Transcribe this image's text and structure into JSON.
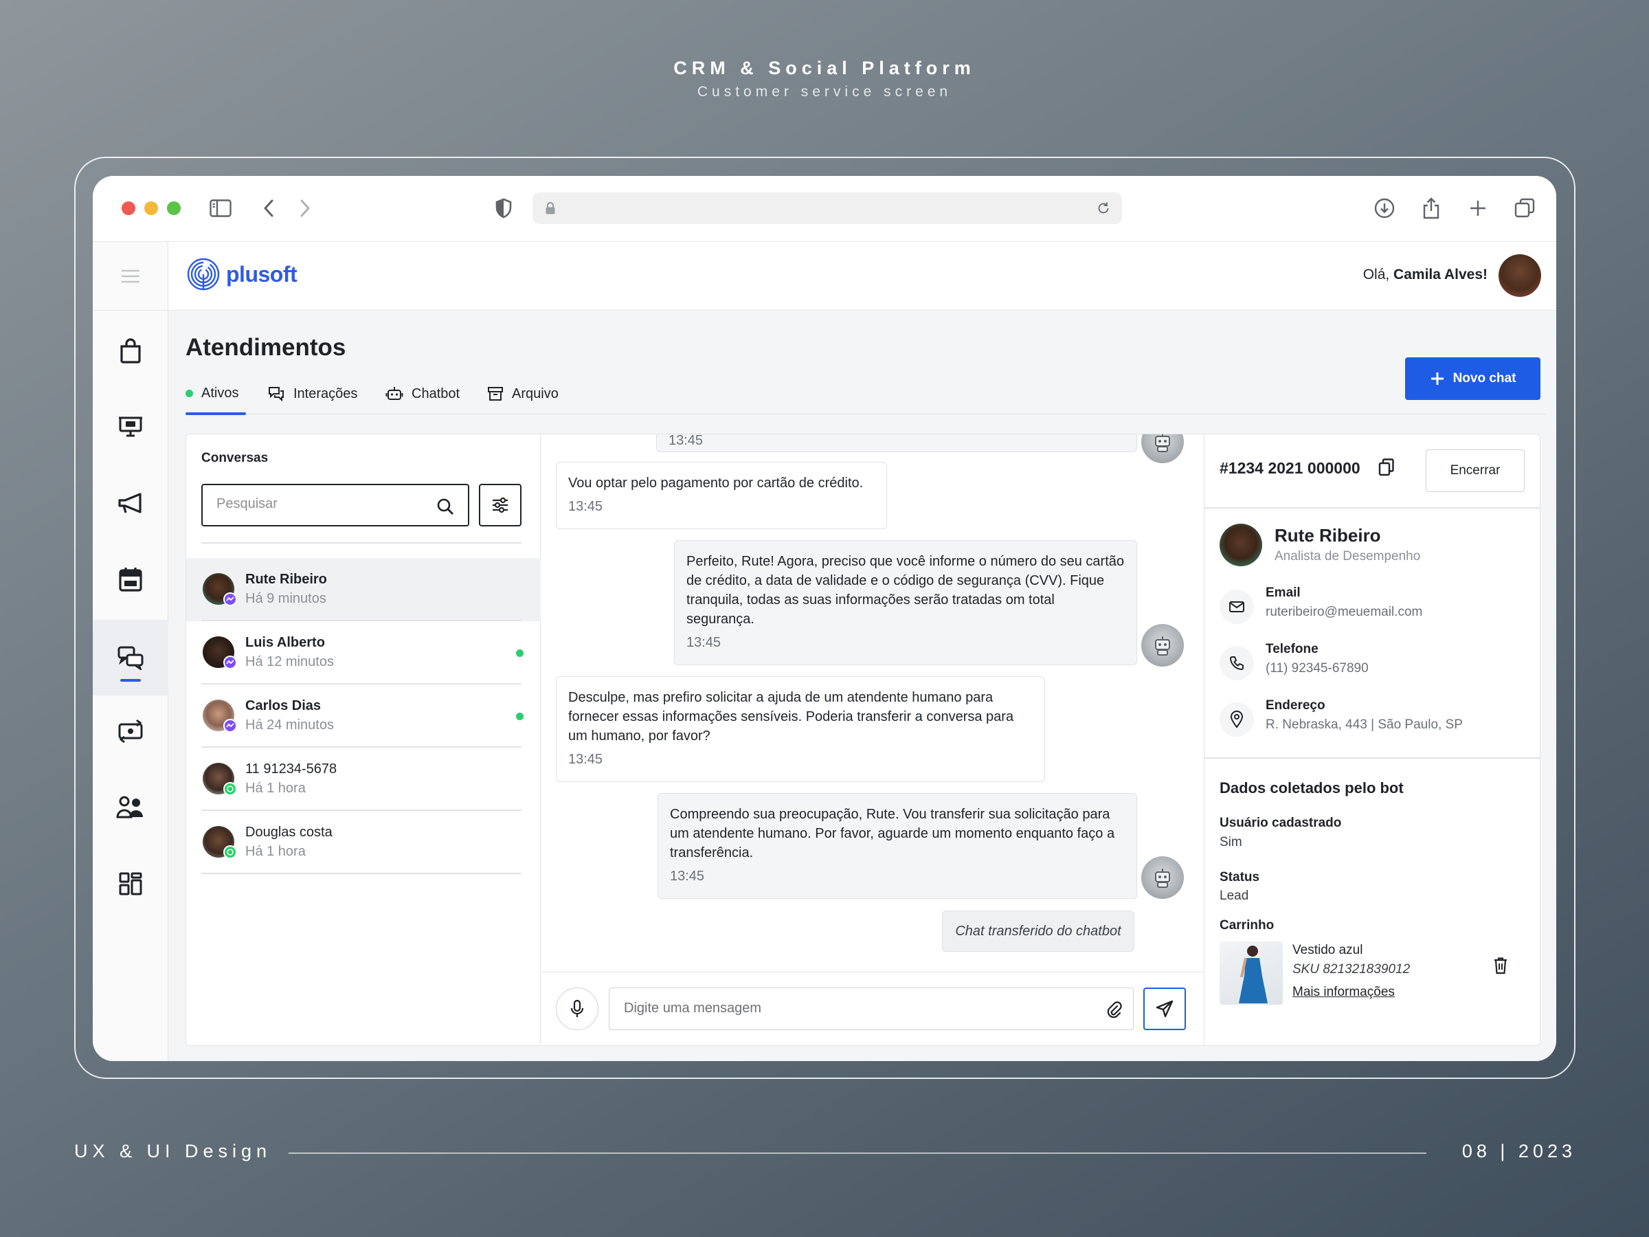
{
  "showcase": {
    "title": "CRM & Social Platform",
    "subtitle": "Customer service screen",
    "footer_left": "UX & UI Design",
    "footer_right": "08 | 2023"
  },
  "app": {
    "brand": "plusoft",
    "greeting_prefix": "Olá, ",
    "user_name": "Camila Alves!",
    "page_title": "Atendimentos",
    "new_chat_label": "Novo chat",
    "tabs": [
      {
        "label": "Ativos",
        "icon": "status-dot",
        "active": true
      },
      {
        "label": "Interações",
        "icon": "chat-bubbles-icon"
      },
      {
        "label": "Chatbot",
        "icon": "robot-icon"
      },
      {
        "label": "Arquivo",
        "icon": "archive-icon"
      }
    ],
    "sidebar": [
      "shopping-bag-icon",
      "presentation-icon",
      "megaphone-icon",
      "calendar-icon",
      "chat-icon",
      "exchange-icon",
      "users-icon",
      "dashboard-icon"
    ]
  },
  "conversations": {
    "title": "Conversas",
    "search_placeholder": "Pesquisar",
    "items": [
      {
        "name": "Rute Ribeiro",
        "time": "Há 9 minutos",
        "channel": "messenger",
        "selected": true,
        "online": false
      },
      {
        "name": "Luis Alberto",
        "time": "Há 12 minutos",
        "channel": "messenger",
        "online": true
      },
      {
        "name": "Carlos Dias",
        "time": "Há 24 minutos",
        "channel": "messenger",
        "online": true
      },
      {
        "name": "11 91234-5678",
        "time": "Há 1 hora",
        "channel": "whatsapp",
        "online": false
      },
      {
        "name": "Douglas costa",
        "time": "Há 1 hora",
        "channel": "whatsapp",
        "online": false
      }
    ]
  },
  "chat": {
    "messages": [
      {
        "from": "user",
        "text": "Vou optar pelo pagamento por cartão de crédito.",
        "time": "13:45"
      },
      {
        "from": "bot",
        "text": "Perfeito, Rute! Agora, preciso que você informe o número do seu cartão de crédito, a data de validade e o código de segurança (CVV). Fique tranquila, todas as suas informações serão tratadas om total segurança.",
        "time": "13:45"
      },
      {
        "from": "user",
        "text": "Desculpe, mas prefiro solicitar a ajuda de um atendente humano para fornecer essas informações sensíveis. Poderia transferir a conversa para um humano, por favor?",
        "time": "13:45"
      },
      {
        "from": "bot",
        "text": "Compreendo sua preocupação, Rute. Vou transferir sua solicitação para um atendente humano. Por favor, aguarde um momento enquanto faço a transferência.",
        "time": "13:45"
      }
    ],
    "partial_time": "13:45",
    "system_note": "Chat transferido do chatbot",
    "input_placeholder": "Digite uma mensagem"
  },
  "details": {
    "ticket": "#1234 2021 000000",
    "close_label": "Encerrar",
    "contact": {
      "name": "Rute Ribeiro",
      "role": "Analista de Desempenho",
      "email_label": "Email",
      "email": "ruteribeiro@meuemail.com",
      "phone_label": "Telefone",
      "phone": "(11) 92345-67890",
      "address_label": "Endereço",
      "address": "R. Nebraska, 443 | São Paulo, SP"
    },
    "bot_data": {
      "title": "Dados coletados pelo bot",
      "registered_label": "Usuário cadastrado",
      "registered_value": "Sim",
      "status_label": "Status",
      "status_value": "Lead",
      "cart_label": "Carrinho",
      "product_name": "Vestido azul",
      "product_sku": "SKU 821321839012",
      "more_info": "Mais informações"
    }
  },
  "colors": {
    "accent": "#1f5ce6",
    "online": "#2ecc71",
    "messenger": "#7b4dff",
    "whatsapp": "#25d366"
  }
}
